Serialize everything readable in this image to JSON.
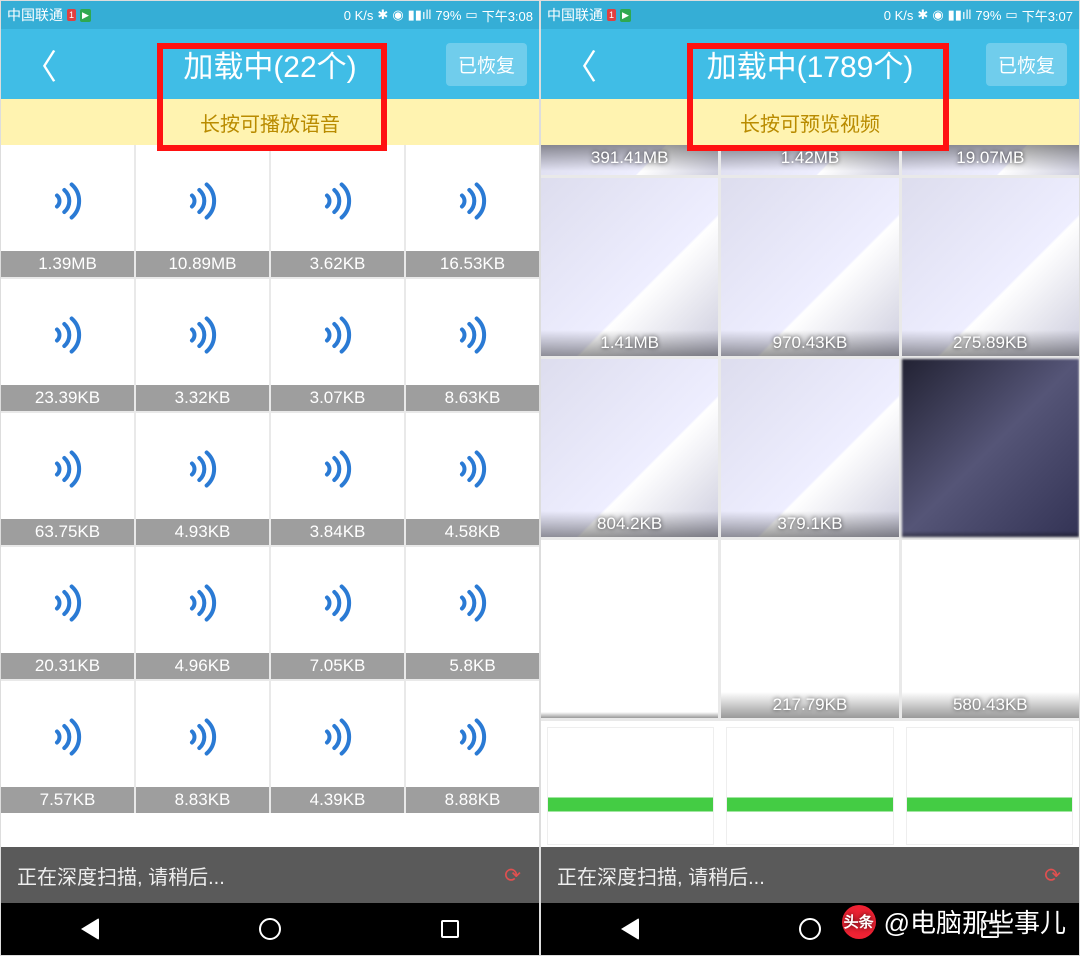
{
  "watermark": {
    "logo_text": "头条",
    "text": "@电脑那些事儿"
  },
  "left": {
    "status": {
      "carrier": "中国联通",
      "speed": "0 K/s",
      "battery": "79%",
      "time": "下午3:08"
    },
    "title": "加载中(22个)",
    "restored_btn": "已恢复",
    "hint": "长按可播放语音",
    "scan_text": "正在深度扫描, 请稍后...",
    "audio_sizes": [
      "1.39MB",
      "10.89MB",
      "3.62KB",
      "16.53KB",
      "23.39KB",
      "3.32KB",
      "3.07KB",
      "8.63KB",
      "63.75KB",
      "4.93KB",
      "3.84KB",
      "4.58KB",
      "20.31KB",
      "4.96KB",
      "7.05KB",
      "5.8KB",
      "7.57KB",
      "8.83KB",
      "4.39KB",
      "8.88KB"
    ]
  },
  "right": {
    "status": {
      "carrier": "中国联通",
      "speed": "0 K/s",
      "battery": "79%",
      "time": "下午3:07"
    },
    "title": "加载中(1789个)",
    "restored_btn": "已恢复",
    "hint": "长按可预览视频",
    "scan_text": "正在深度扫描, 请稍后...",
    "videos_row0": [
      "391.41MB",
      "1.42MB",
      "19.07MB"
    ],
    "videos_row1": [
      "1.41MB",
      "970.43KB",
      "275.89KB"
    ],
    "videos_row2": [
      "804.2KB",
      "379.1KB",
      ""
    ],
    "videos_row3": [
      "",
      "217.79KB",
      "580.43KB"
    ]
  }
}
